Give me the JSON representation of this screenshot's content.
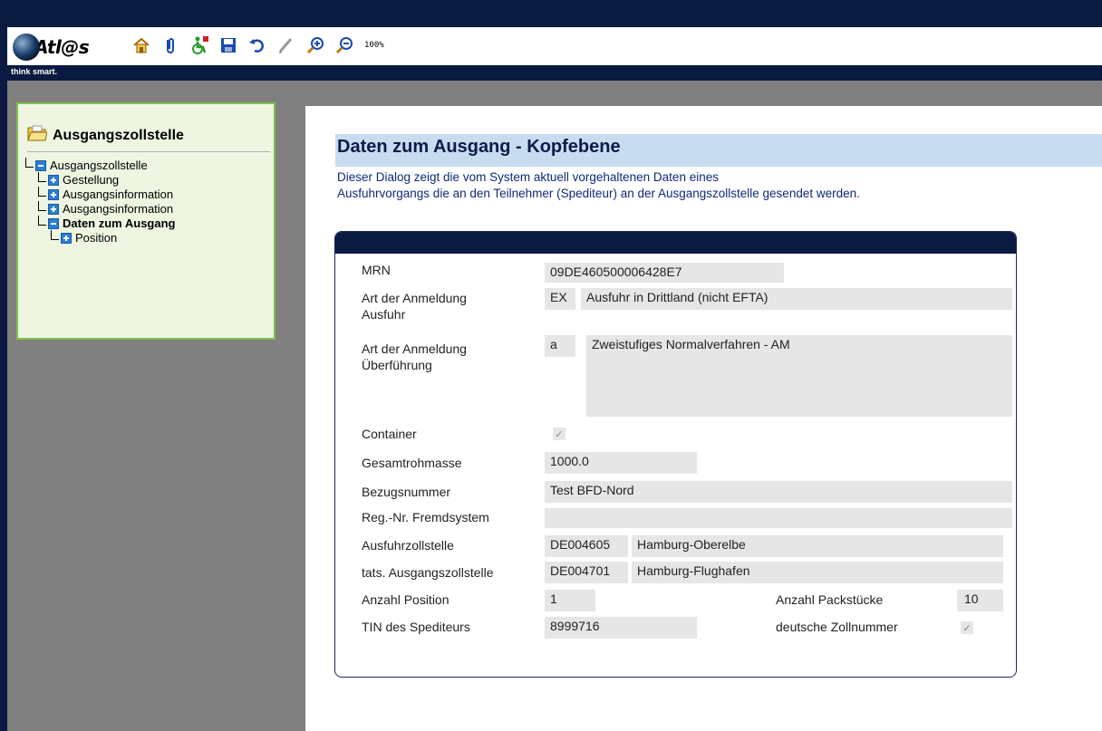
{
  "app": {
    "logo_text": "Atl@s",
    "tagline": "think smart.",
    "zoom": "100%"
  },
  "toolbar": {
    "icons": [
      "home-icon",
      "attach-icon",
      "accessibility-icon",
      "save-icon",
      "undo-icon",
      "edit-icon",
      "zoom-in-icon",
      "zoom-out-icon"
    ]
  },
  "sidebar": {
    "title": "Ausgangszollstelle",
    "tree": [
      {
        "label": "Ausgangszollstelle",
        "level": 0,
        "expanded": true,
        "bold": false
      },
      {
        "label": "Gestellung",
        "level": 1,
        "expanded": false,
        "bold": false
      },
      {
        "label": "Ausgangsinformation",
        "level": 1,
        "expanded": false,
        "bold": false
      },
      {
        "label": "Ausgangsinformation",
        "level": 1,
        "expanded": false,
        "bold": false
      },
      {
        "label": "Daten zum Ausgang",
        "level": 1,
        "expanded": true,
        "bold": true
      },
      {
        "label": "Position",
        "level": 2,
        "expanded": false,
        "bold": false
      }
    ]
  },
  "page": {
    "title": "Daten zum Ausgang - Kopfebene",
    "desc_line1": "Dieser Dialog zeigt die vom System aktuell vorgehaltenen Daten eines",
    "desc_line2": "Ausfuhrvorgangs die an den Teilnehmer (Spediteur) an der Ausgangszollstelle gesendet werden."
  },
  "form": {
    "mrn_label": "MRN",
    "mrn_value": "09DE460500006428E7",
    "art_ausfuhr_label1": "Art der Anmeldung",
    "art_ausfuhr_label2": "Ausfuhr",
    "art_ausfuhr_code": "EX",
    "art_ausfuhr_text": "Ausfuhr in Drittland (nicht EFTA)",
    "art_ueber_label1": "Art der Anmeldung",
    "art_ueber_label2": "Überführung",
    "art_ueber_code": "a",
    "art_ueber_text": "Zweistufiges Normalverfahren - AM",
    "container_label": "Container",
    "container_checked": true,
    "gesamt_label": "Gesamtrohmasse",
    "gesamt_value": "1000.0",
    "bezug_label": "Bezugsnummer",
    "bezug_value": "Test BFD-Nord",
    "reg_label": "Reg.-Nr. Fremdsystem",
    "reg_value": "",
    "ausfuhrzoll_label": "Ausfuhrzollstelle",
    "ausfuhrzoll_code": "DE004605",
    "ausfuhrzoll_name": "Hamburg-Oberelbe",
    "tats_label": "tats. Ausgangszollstelle",
    "tats_code": "DE004701",
    "tats_name": "Hamburg-Flughafen",
    "anz_pos_label": "Anzahl Position",
    "anz_pos_value": "1",
    "anz_pack_label": "Anzahl Packstücke",
    "anz_pack_value": "10",
    "tin_label": "TIN des Spediteurs",
    "tin_value": "8999716",
    "zollnr_label": "deutsche Zollnummer",
    "zollnr_checked": true
  }
}
